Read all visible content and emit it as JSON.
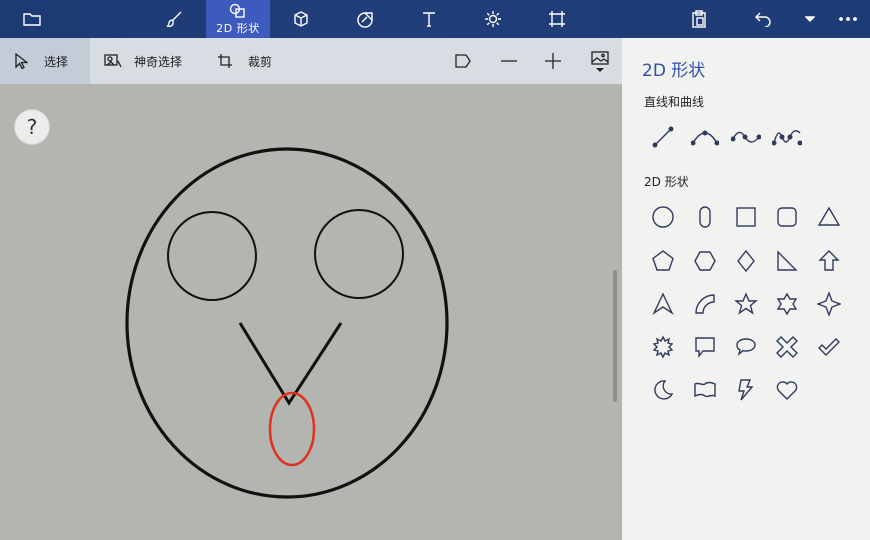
{
  "toolbar": {
    "active_tab_label": "2D 形状",
    "items": [
      "folder-icon",
      "brush-icon",
      "2d-shapes-icon",
      "3d-cube-icon",
      "sticker-icon",
      "text-icon",
      "effects-icon",
      "canvas-icon",
      "paste-icon",
      "undo-icon",
      "history-dropdown-icon",
      "more-icon"
    ]
  },
  "subbar": {
    "select_label": "选择",
    "magic_select_label": "神奇选择",
    "crop_label": "裁剪"
  },
  "canvas": {
    "help_label": "?",
    "stroke_color": "#111111",
    "highlight_color": "#e0301e"
  },
  "panel": {
    "title": "2D 形状",
    "lines_section": "直线和曲线",
    "shapes_section": "2D 形状",
    "accent_color": "#2f4fa8"
  }
}
